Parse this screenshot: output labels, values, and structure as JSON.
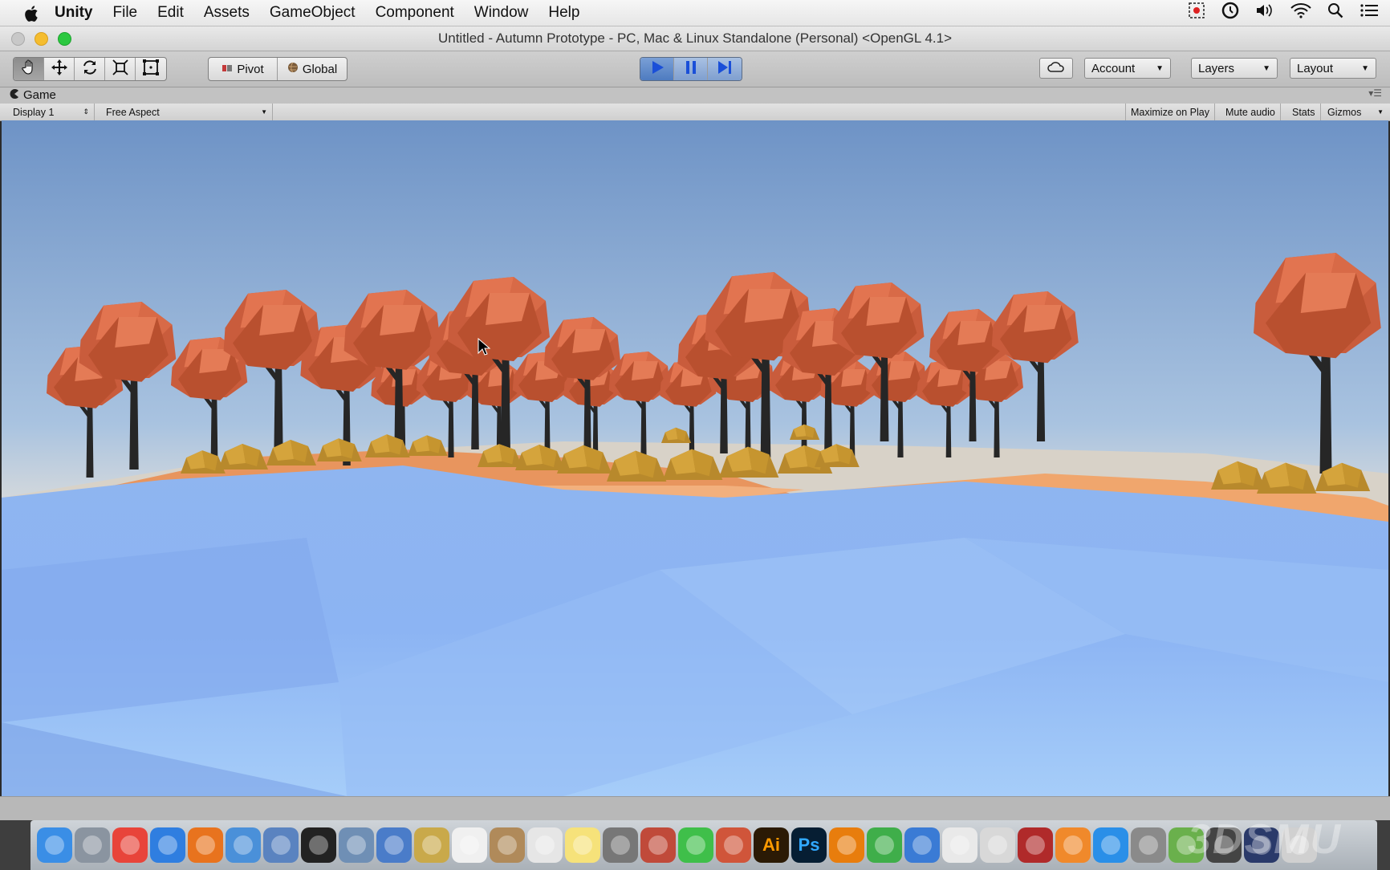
{
  "menubar": {
    "app": "Unity",
    "items": [
      "File",
      "Edit",
      "Assets",
      "GameObject",
      "Component",
      "Window",
      "Help"
    ],
    "status_icons": [
      "screen-record-icon",
      "time-machine-icon",
      "volume-icon",
      "wifi-icon",
      "spotlight-icon",
      "notification-center-icon"
    ]
  },
  "window": {
    "title": "Untitled - Autumn Prototype - PC, Mac & Linux Standalone (Personal) <OpenGL 4.1>"
  },
  "toolbar": {
    "tools": [
      "hand-tool-icon",
      "move-tool-icon",
      "rotate-tool-icon",
      "scale-tool-icon",
      "rect-tool-icon"
    ],
    "pivot_label": "Pivot",
    "global_label": "Global",
    "play_icon": "play-icon",
    "pause_icon": "pause-icon",
    "step_icon": "step-icon",
    "cloud_icon": "cloud-icon",
    "account_label": "Account",
    "layers_label": "Layers",
    "layout_label": "Layout"
  },
  "game_panel": {
    "tab_label": "Game",
    "display_label": "Display 1",
    "aspect_label": "Free Aspect",
    "maximize_label": "Maximize on Play",
    "mute_label": "Mute audio",
    "stats_label": "Stats",
    "gizmos_label": "Gizmos"
  },
  "dock": {
    "apps": [
      {
        "name": "finder-icon",
        "color": "#3a8ee6"
      },
      {
        "name": "launchpad-icon",
        "color": "#8a94a0"
      },
      {
        "name": "chrome-icon",
        "color": "#e8443a"
      },
      {
        "name": "safari-icon",
        "color": "#2f7ee0"
      },
      {
        "name": "firefox-icon",
        "color": "#e8731e"
      },
      {
        "name": "xcode-icon",
        "color": "#4a90d9"
      },
      {
        "name": "instruments-icon",
        "color": "#5a83c0"
      },
      {
        "name": "unity-icon",
        "color": "#222222"
      },
      {
        "name": "vpn-icon",
        "color": "#6f8fb5"
      },
      {
        "name": "fruit-app-icon",
        "color": "#4a7cc9"
      },
      {
        "name": "paint-icon",
        "color": "#c9a94a"
      },
      {
        "name": "photos-icon",
        "color": "#f0f0f0"
      },
      {
        "name": "contacts-icon",
        "color": "#b08a5a"
      },
      {
        "name": "textedit-icon",
        "color": "#e6e6e6"
      },
      {
        "name": "notes-icon",
        "color": "#f6e27a"
      },
      {
        "name": "calculator-icon",
        "color": "#777777"
      },
      {
        "name": "cocktail-icon",
        "color": "#c04a3a"
      },
      {
        "name": "facetime-icon",
        "color": "#3fbf4a"
      },
      {
        "name": "html5-icon",
        "color": "#d0553a"
      },
      {
        "name": "illustrator-icon",
        "color": "#2b1a05",
        "text": "Ai",
        "text_color": "#ff9a00"
      },
      {
        "name": "photoshop-icon",
        "color": "#061e33",
        "text": "Ps",
        "text_color": "#31a8ff"
      },
      {
        "name": "blender-icon",
        "color": "#e87d0d"
      },
      {
        "name": "numbers-icon",
        "color": "#3fae4a"
      },
      {
        "name": "keynote-icon",
        "color": "#3a7bd5"
      },
      {
        "name": "itunes-icon",
        "color": "#e9e9e9"
      },
      {
        "name": "preview-icon",
        "color": "#d8d8d8"
      },
      {
        "name": "photo-booth-icon",
        "color": "#b02a2a"
      },
      {
        "name": "ibooks-icon",
        "color": "#f0892b"
      },
      {
        "name": "app-store-icon",
        "color": "#2a8fe8"
      },
      {
        "name": "system-preferences-icon",
        "color": "#8a8a8a"
      },
      {
        "name": "android-icon",
        "color": "#6ab04c"
      },
      {
        "name": "pen-tool-icon",
        "color": "#444444"
      },
      {
        "name": "activity-monitor-icon",
        "color": "#2a3a6a"
      },
      {
        "name": "trash-icon",
        "color": "#d0d0d0"
      }
    ]
  }
}
